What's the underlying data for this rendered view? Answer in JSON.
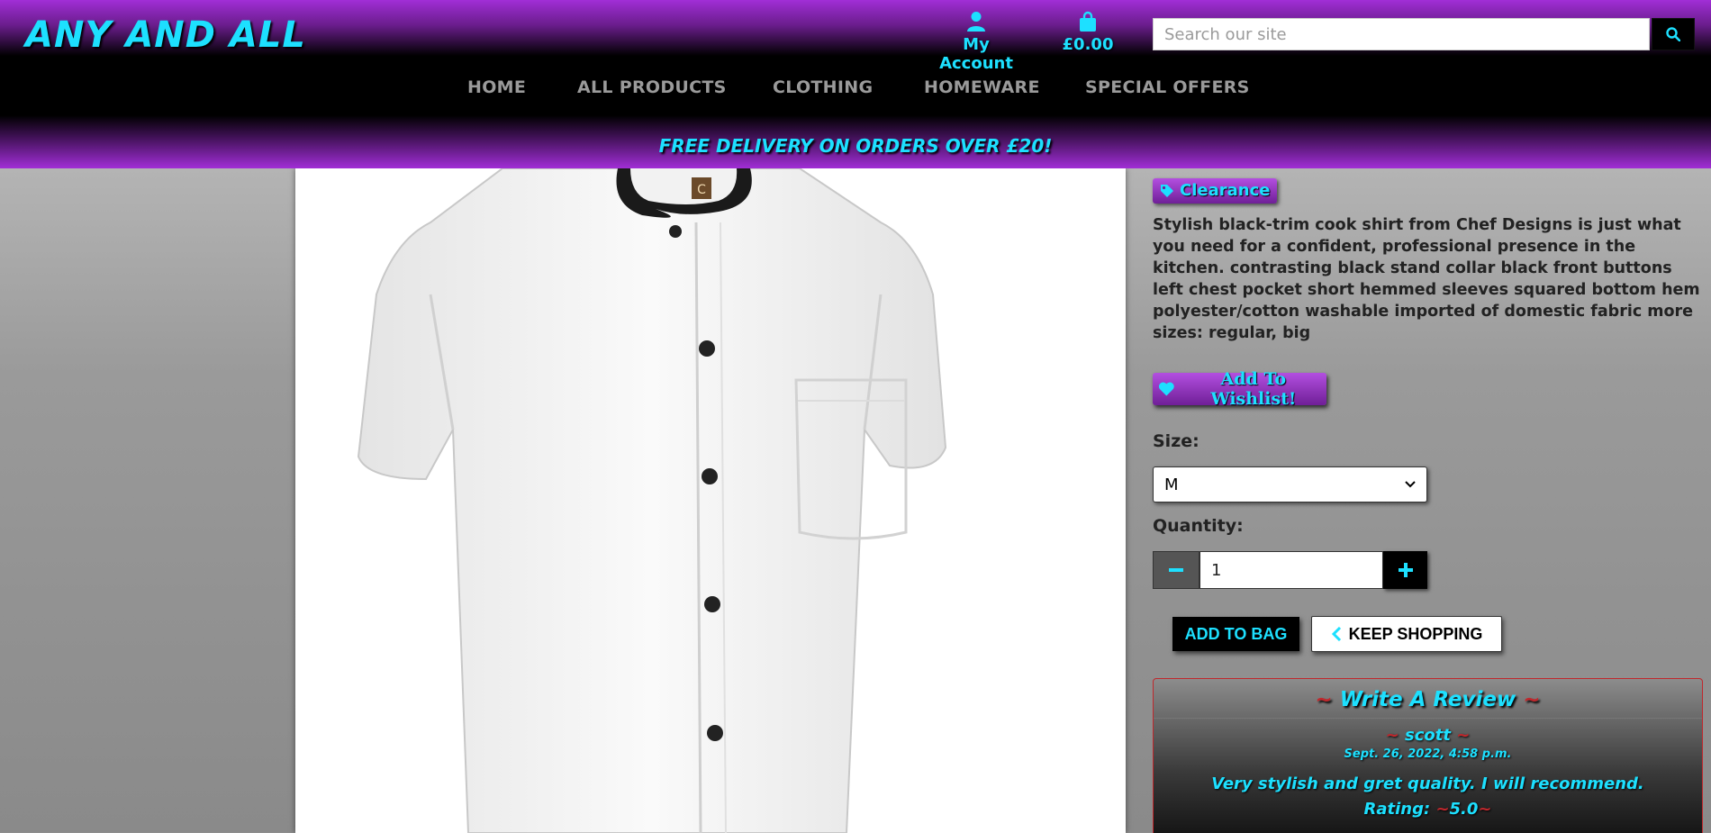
{
  "header": {
    "logo": "ANY AND ALL",
    "account_label": "My Account",
    "bag_total": "£0.00",
    "search_placeholder": "Search our site"
  },
  "nav": {
    "items": [
      "HOME",
      "ALL PRODUCTS",
      "CLOTHING",
      "HOMEWARE",
      "SPECIAL OFFERS"
    ]
  },
  "promo": "FREE DELIVERY ON ORDERS OVER £20!",
  "product": {
    "badge": "Clearance",
    "description": "Stylish black-trim cook shirt from Chef Designs is just what you need for a confident, professional presence in the kitchen. contrasting black stand collar black front buttons left chest pocket short hemmed sleeves squared bottom hem polyester/cotton washable imported of domestic fabric more sizes: regular, big",
    "wishlist_label": "Add To Wishlist!",
    "size_label": "Size:",
    "size_value": "M",
    "quantity_label": "Quantity:",
    "quantity_value": "1",
    "add_to_bag_label": "ADD TO BAG",
    "keep_shopping_label": "KEEP SHOPPING"
  },
  "review": {
    "title": "Write A Review",
    "author": "scott",
    "date": "Sept. 26, 2022, 4:58 p.m.",
    "body": "Very stylish and gret quality. I will recommend.",
    "rating_label": "Rating:",
    "rating_value": "5.0"
  },
  "colors": {
    "accent": "#1de0ff",
    "purple": "#a12ed6",
    "tilde_red": "#c0282d"
  },
  "icons": {
    "account": "user-icon",
    "bag": "shopping-bag-icon",
    "search": "search-icon",
    "badge": "tag-icon",
    "wishlist": "heart-icon",
    "keep_shopping": "chevron-left-icon"
  }
}
